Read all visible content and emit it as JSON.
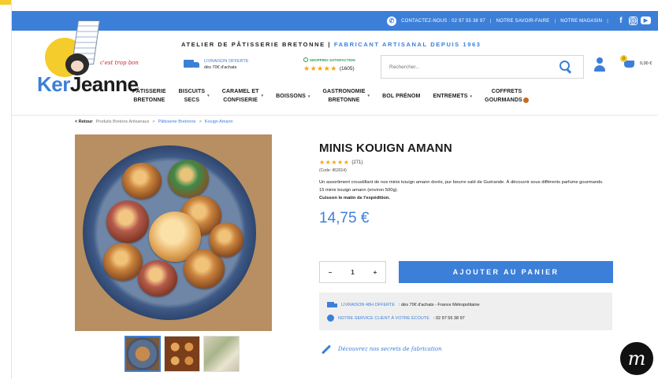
{
  "topbar": {
    "contact": "CONTACTEZ-NOUS : 02 97 55 38 97",
    "savoir_faire": "NOTRE SAVOIR-FAIRE",
    "magasin": "NOTRE MAGASIN",
    "facebook_glyph": "f",
    "instagram_glyph": "◎",
    "youtube_glyph": "▶"
  },
  "logo": {
    "brand_ker": "Ker",
    "brand_jeanne": "Jeanne",
    "tagline": "c'est trop bon"
  },
  "header": {
    "atelier_prefix": "ATELIER DE PÂTISSERIE BRETONNE |",
    "atelier_suffix": "FABRICANT ARTISANAL DEPUIS 1963",
    "delivery_line1": "LIVRAISON OFFERTE",
    "delivery_line2": "dès 70€ d'achats",
    "shopping_label": "SHOPPING SATISFACTION",
    "rating_stars": "★★★★★",
    "rating_count": "(1605)",
    "search_placeholder": "Rechercher...",
    "cart_badge": "0",
    "cart_total": "0,00 €"
  },
  "nav": {
    "items": [
      {
        "line1": "PÂTISSERIE",
        "line2": "BRETONNE"
      },
      {
        "line1": "BISCUITS",
        "line2": "SECS"
      },
      {
        "line1": "CARAMEL ET",
        "line2": "CONFISERIE"
      },
      {
        "line1": "BOISSONS",
        "line2": ""
      },
      {
        "line1": "GASTRONOMIE",
        "line2": "BRETONNE"
      },
      {
        "line1": "BOL PRÉNOM",
        "line2": ""
      },
      {
        "line1": "ENTREMETS",
        "line2": ""
      },
      {
        "line1": "COFFRETS",
        "line2": "GOURMANDS"
      }
    ]
  },
  "breadcrumb": {
    "back": "< Retour",
    "level1": "Produits Bretons Artisanaux",
    "sep": ">",
    "level2": "Pâtisserie Bretonne",
    "level3": "Kouign Amann"
  },
  "product": {
    "title": "MINIS KOUIGN AMANN",
    "stars": "★★★★★",
    "review_count": "(271)",
    "code": "(Code: 452014)",
    "desc1": "Un assortiment croustillant de nos minis kouign amann dorés, pur beurre salé de Guérande. À découvrir sous différents parfums gourmands.",
    "desc2": "15 minis kouign amann (environ 500g).",
    "desc3": "Cuisson le matin de l'expédition.",
    "price": "14,75 €",
    "qty_minus": "−",
    "qty_value": "1",
    "qty_plus": "+",
    "add_to_cart": "AJOUTER AU PANIER"
  },
  "info": {
    "delivery_blue": "LIVRAISON 48H OFFERTE",
    "delivery_dark": ": dès 70€ d'achats - France Métropolitaine",
    "service_blue": "NOTRE SERVICE CLIENT À VOTRE ÉCOUTE",
    "service_dark": ": 02 97 55 38 97"
  },
  "secrets": "Découvrez nos secrets de fabrication",
  "floating_logo": "m",
  "colors": {
    "accent": "#3c7fd8",
    "yellow": "#f4cc2b",
    "stars": "#f2a716"
  }
}
